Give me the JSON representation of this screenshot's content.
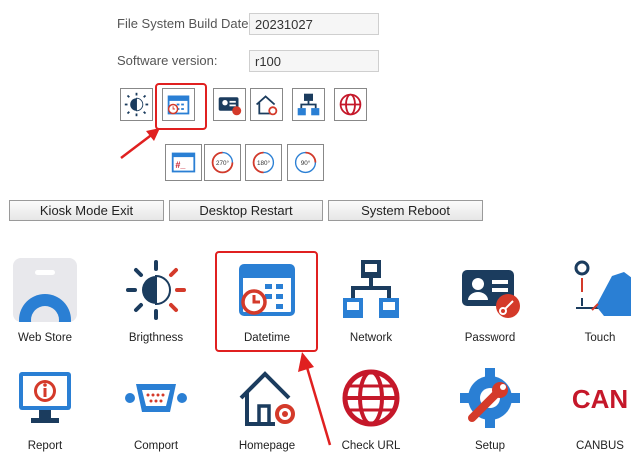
{
  "settings": {
    "fs_date_label": "File System Build Date:",
    "fs_date_value": "20231027",
    "sw_label": "Software version:",
    "sw_value": "r100"
  },
  "toolbar_icons": [
    "brightness-icon",
    "datetime-icon",
    "password-icon",
    "homepage-icon",
    "network-icon",
    "check-url-icon"
  ],
  "rotate_icons": {
    "terminal": "#_",
    "r270": "270°",
    "r180": "180°",
    "r90": "90°"
  },
  "buttons": {
    "kiosk": "Kiosk Mode Exit",
    "desktop": "Desktop Restart",
    "reboot": "System Reboot"
  },
  "apps": {
    "web_store": "Web Store",
    "brightness": "Brigthness",
    "datetime": "Datetime",
    "network": "Network",
    "password": "Password",
    "touch": "Touch",
    "report": "Report",
    "comport": "Comport",
    "homepage": "Homepage",
    "check_url": "Check URL",
    "setup": "Setup",
    "canbus": "CANBUS",
    "canbus_logo": "CAN"
  },
  "colors": {
    "accent": "#2a7fd4",
    "highlight": "#e02020",
    "dark": "#1b3c5e"
  }
}
